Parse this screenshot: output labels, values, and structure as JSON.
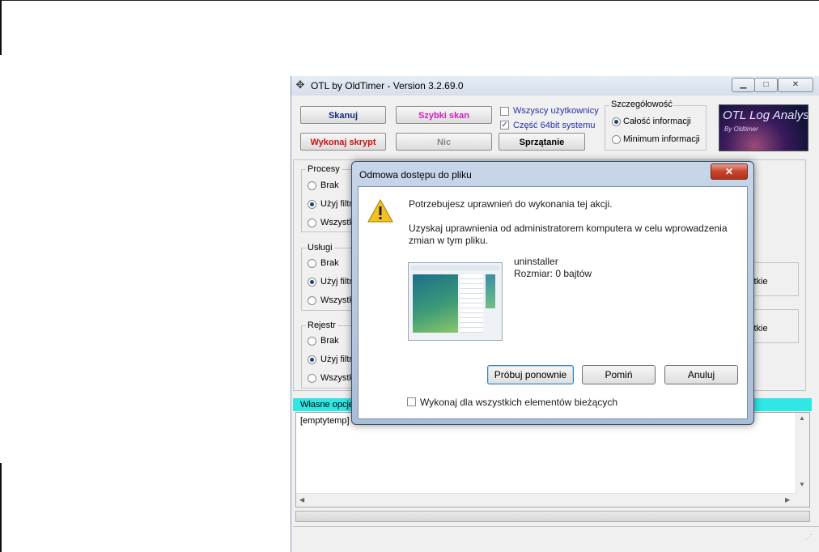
{
  "window": {
    "title": "OTL by OldTimer - Version 3.2.69.0",
    "minimize": "▁",
    "maximize": "□",
    "close": "✕"
  },
  "toolbar": {
    "scan": "Skanuj",
    "quick_scan": "Szybki skan",
    "run_script": "Wykonaj skrypt",
    "none": "Nic",
    "cleanup": "Sprzątanie",
    "all_users": "Wszyscy użytkownicy",
    "part64": "Część 64bit systemu"
  },
  "detail": {
    "legend": "Szczegółowość",
    "full": "Całość informacji",
    "minimum": "Minimum informacji"
  },
  "logo": {
    "line1": "OTL Log Analysis",
    "line2": "By Oldtimer"
  },
  "groups": {
    "processes": {
      "legend": "Procesy",
      "none": "Brak",
      "filter": "Użyj filtr",
      "all": "Wszystk"
    },
    "services": {
      "legend": "Usługi",
      "none": "Brak",
      "filter": "Użyj filtr",
      "all": "Wszystk"
    },
    "registry": {
      "legend": "Rejestr",
      "none": "Brak",
      "filter": "Użyj filtr",
      "all": "Wszystk"
    }
  },
  "right_partial": {
    "a": "stkie",
    "b": "stkie"
  },
  "custom": {
    "header": "Własne opcje",
    "text": "[emptytemp]"
  },
  "dialog": {
    "title": "Odmowa dostępu do pliku",
    "close": "✕",
    "line1": "Potrzebujesz uprawnień do wykonania tej akcji.",
    "line2a": "Uzyskaj uprawnienia od administratorem komputera w celu wprowadzenia",
    "line2b": "zmian w tym pliku.",
    "file_name": "uninstaller",
    "file_size": "Rozmiar: 0 bajtów",
    "retry": "Próbuj ponownie",
    "skip": "Pomiń",
    "cancel": "Anuluj",
    "apply_all": "Wykonaj dla wszystkich elementów bieżących"
  }
}
